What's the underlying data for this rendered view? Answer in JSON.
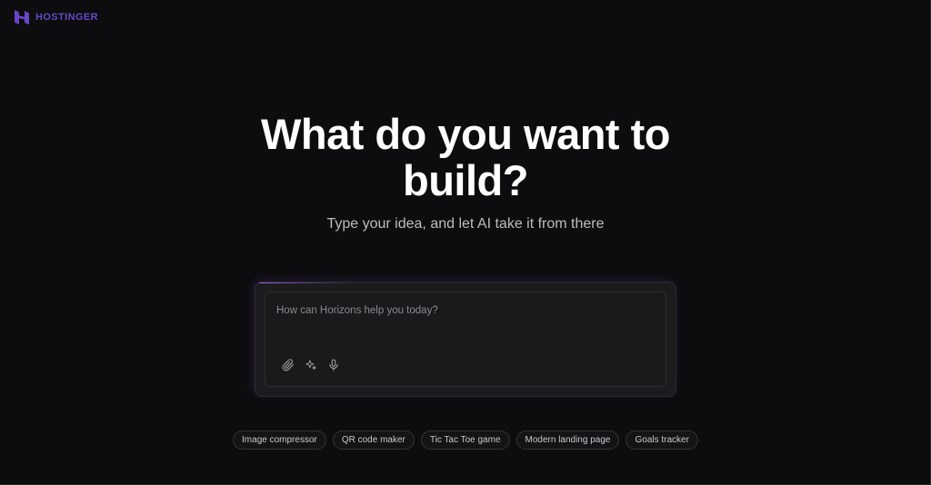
{
  "brand": {
    "name": "HOSTINGER",
    "logo_icon": "hostinger-h-logo",
    "color": "#6747c7"
  },
  "hero": {
    "title": "What do you want to build?",
    "subtitle": "Type your idea, and let AI take it from there"
  },
  "prompt": {
    "placeholder": "How can Horizons help you today?",
    "value": "",
    "tools": [
      {
        "icon": "paperclip-icon"
      },
      {
        "icon": "sparkle-icon"
      },
      {
        "icon": "microphone-icon"
      }
    ]
  },
  "suggestions": [
    "Image compressor",
    "QR code maker",
    "Tic Tac Toe game",
    "Modern landing page",
    "Goals tracker"
  ],
  "colors": {
    "background": "#0d0c0e",
    "card": "#1c1b1e",
    "accent": "#6747c7"
  }
}
